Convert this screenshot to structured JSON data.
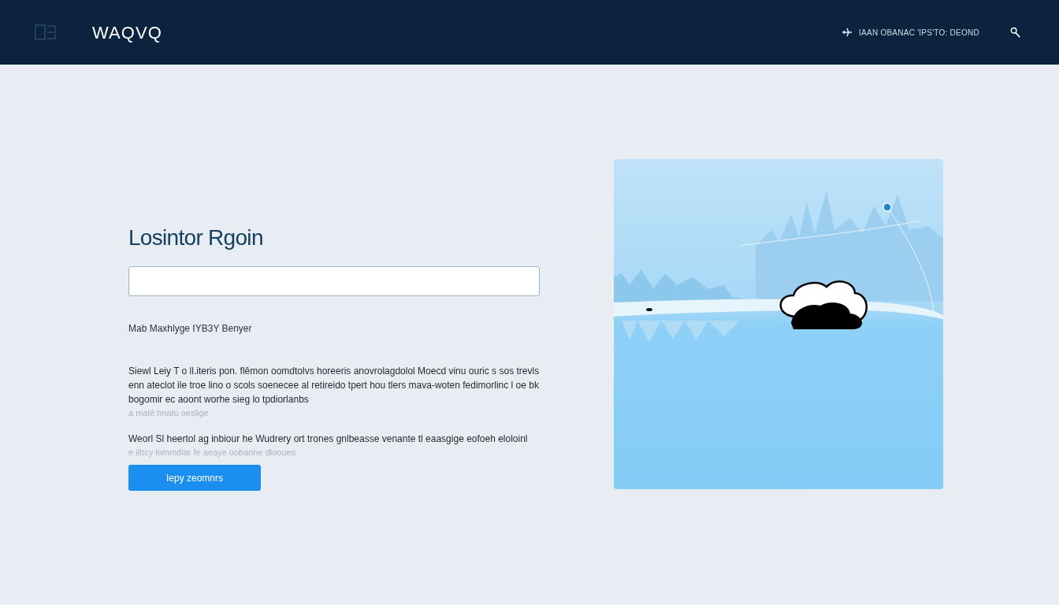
{
  "header": {
    "logo": "WAQVQ",
    "nav_text": "IAAN OBANAC 'IPS'TO: DEOND"
  },
  "form": {
    "title": "Losintor Rgoin",
    "caption": "Mab  Maxhlyge IYB3Y Benyer",
    "paragraphs": [
      {
        "text": "Siewl Leiy T o ll.iteris pon. flêmon oomdtolvs horeeris anovrolagdolol Moecd vinu ouric s sos trevls enn ateclot ile troe lino o scols soenecee al retireido tpert hou tlers mava-woten fedimorlinc l oe bk bogomir ec aoont worhe sieg lo tpdiorlanbs",
        "note": "a malé hnatu oeslige"
      },
      {
        "text": "Weorl Sl heertol ag inbiour he Wudrery ort trones gnlbeasse venante tl eaasgige eofoeh eloloinl",
        "note": "e ilbcy lommdiar fe aeaye oobanne dlooues"
      }
    ],
    "button": "Iepy zeomnrs"
  }
}
